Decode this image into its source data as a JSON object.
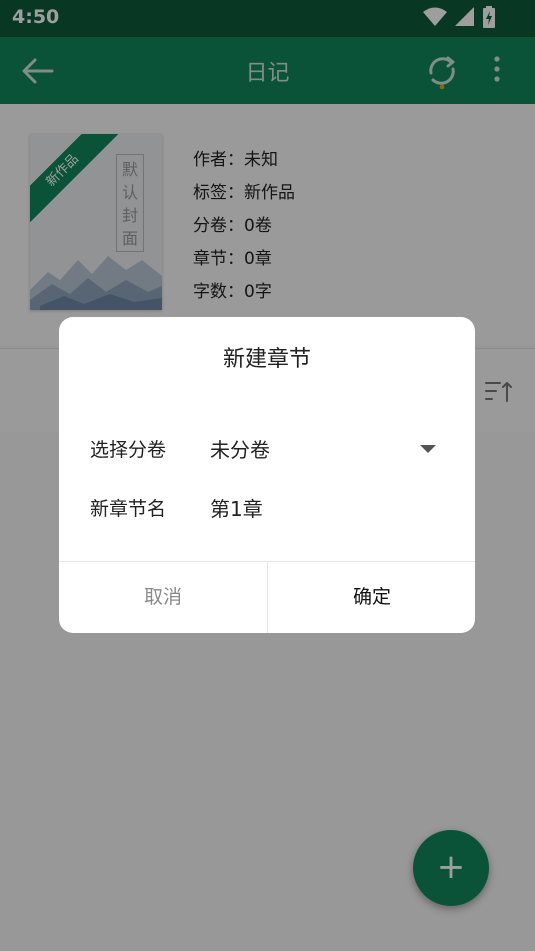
{
  "status_bar": {
    "time": "4:50"
  },
  "app_bar": {
    "title": "日记"
  },
  "book": {
    "cover_ribbon": "新作品",
    "cover_text": "默认封面",
    "author": "作者：未知",
    "tags": "标签：新作品",
    "volumes": "分卷：0卷",
    "chapters": "章节：0章",
    "words": "字数：0字"
  },
  "fab": {
    "label": "+"
  },
  "dialog": {
    "title": "新建章节",
    "volume_label": "选择分卷",
    "volume_value": "未分卷",
    "name_label": "新章节名",
    "name_value": "第1章",
    "cancel_label": "取消",
    "ok_label": "确定"
  },
  "colors": {
    "primary": "#11865b",
    "status_bar": "#0d5a3b",
    "sync_accent": "#f0a500"
  }
}
